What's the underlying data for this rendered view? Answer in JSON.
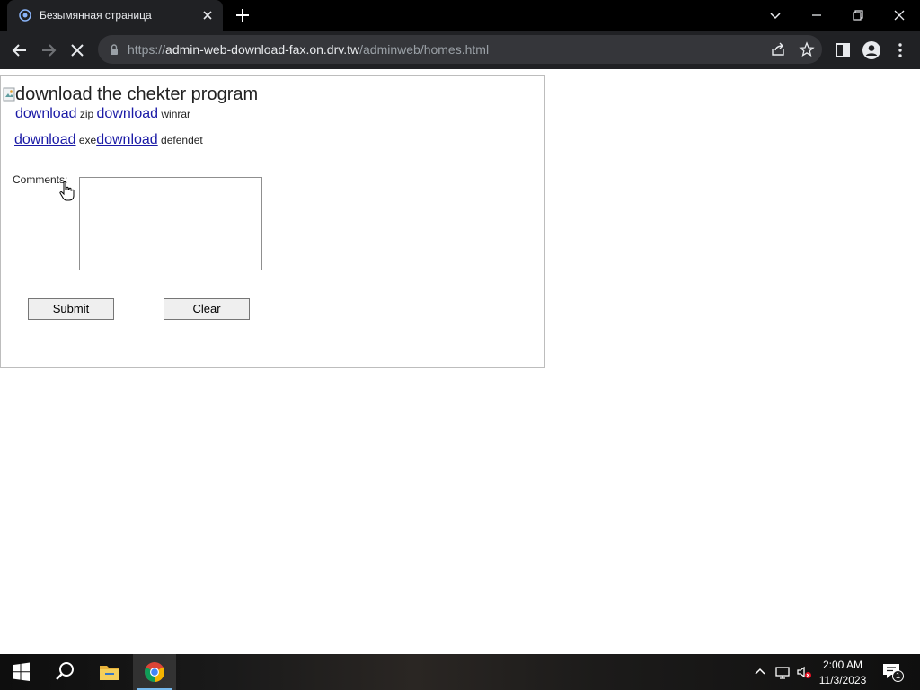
{
  "browser": {
    "tab": {
      "title": "Безымянная страница",
      "favicon": "page-globe-icon",
      "close_icon": "close-icon"
    },
    "new_tab_icon": "plus-icon",
    "window_controls": [
      "chevron-down-icon",
      "minimize-icon",
      "restore-icon",
      "close-icon"
    ],
    "toolbar": {
      "back_icon": "back-arrow-icon",
      "forward_icon": "forward-arrow-icon",
      "stop_icon": "stop-loading-icon",
      "url_scheme": "https://",
      "url_host": "admin-web-download-fax.on.drv.tw",
      "url_path": "/adminweb/homes.html",
      "share_icon": "share-icon",
      "bookmark_icon": "star-icon",
      "sidepanel_icon": "side-panel-icon",
      "profile_icon": "profile-icon",
      "menu_icon": "kebab-menu-icon"
    }
  },
  "page": {
    "image_alt": "download the chekter program",
    "downloads": [
      {
        "link": "download",
        "label": "zip"
      },
      {
        "link": "download",
        "label": "winrar"
      },
      {
        "link": "download",
        "label": "exe"
      },
      {
        "link": "download",
        "label": "defendet"
      }
    ],
    "comments_label": "Comments:",
    "comments_value": "",
    "submit_label": "Submit",
    "clear_label": "Clear"
  },
  "taskbar": {
    "start_icon": "windows-start-icon",
    "search_icon": "search-icon",
    "explorer_icon": "file-explorer-icon",
    "chrome_icon": "chrome-icon",
    "tray": [
      "chevron-up-icon",
      "network-icon",
      "volume-muted-icon"
    ],
    "time": "2:00 AM",
    "date": "11/3/2023",
    "notifications_count": "1"
  }
}
